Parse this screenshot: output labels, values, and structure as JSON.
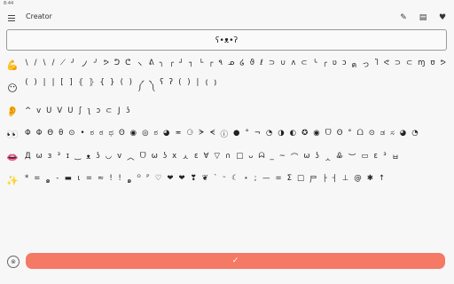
{
  "status": {
    "time": "8:44"
  },
  "appbar": {
    "title": "Creator",
    "icons": [
      "brush-icon",
      "template-icon",
      "heart-icon"
    ],
    "icon_glyphs": [
      "✎",
      "▤",
      "♥"
    ]
  },
  "preview": {
    "text": "ʕ•ᴥ•ʔ"
  },
  "rows": [
    {
      "category": "arms",
      "icon": "💪",
      "chars": [
        "\\",
        "/",
        "\\",
        "/",
        "⟋",
        "╯",
        "ノ",
        "╯",
        "ᕗ",
        "ᕤ",
        "ᕦ",
        "ヽ",
        "ᕕ",
        "╮",
        "╭",
        "┘",
        "┐",
        "└",
        "┌",
        "٩",
        "ᓄ",
        "໒",
        "ϑ",
        "ℓ",
        "⊃",
        "∪",
        "ʌ",
        "⊂",
        "╰",
        "╭",
        "ʋ",
        "ɔ",
        "ค",
        "っ",
        "Ⴈ",
        "ᕙ",
        "⊃",
        "⊂",
        "ɱ",
        "ʊ",
        "ᕗ"
      ]
    },
    {
      "category": "face",
      "icon": "😶",
      "chars": [
        "(",
        ")",
        "|",
        "|",
        "[",
        "]",
        "⦃",
        "⦄",
        "{",
        "}",
        "(",
        ")",
        "༼",
        "༽",
        "ʕ",
        "ʔ",
        "(",
        ")",
        "|",
        "⦅",
        "⦆"
      ]
    },
    {
      "category": "ears",
      "icon": "👂",
      "chars": [
        "^",
        "v",
        "U",
        "V",
        "U",
        "ʃ",
        "ʅ",
        "ɔ",
        "⊂",
        "J",
        "ʖ"
      ]
    },
    {
      "category": "eyes",
      "icon": "👀",
      "chars": [
        "Φ",
        "Φ",
        "Θ",
        "θ",
        "⊙",
        "•",
        "ಠ",
        "ಠ",
        "ಥ",
        "ʘ",
        "◉",
        "◎",
        "ಠ",
        "◕",
        "≖",
        "⚆",
        "ᗒ",
        "ᗕ",
        "ⓘ",
        "●",
        "°",
        "¬",
        "◔",
        "◑",
        "◐",
        "✪",
        "◉",
        "ᗜ",
        "ʘ",
        "͡°",
        "ᗝ",
        "⊙",
        "ಡ",
        "ಸ",
        "◕",
        "◔"
      ]
    },
    {
      "category": "mouth",
      "icon": "👄",
      "chars": [
        "Д",
        "ω",
        "ɜ",
        "³",
        "ɪ",
        "‿",
        "ᴥ",
        "ʖ",
        "◡",
        "v",
        "︿",
        "ᗜ",
        "ω",
        "ʖ",
        "x",
        "ㅅ",
        "ε",
        "∀",
        "▽",
        "∩",
        "□",
        "ᴗ",
        "ᗣ",
        "_",
        "~",
        "⌒",
        "ω",
        "ʖ",
        "ᆺ",
        "Ꮂ",
        "︶",
        "▭",
        "ε",
        "³",
        "ㅂ"
      ]
    },
    {
      "category": "extras",
      "icon": "✨",
      "chars": [
        "*",
        "=",
        "๑",
        "-",
        "▬",
        "ι",
        "=",
        "≈",
        "!",
        "!",
        "๑",
        "ᴼ",
        "ᴾ",
        "♡",
        "❤",
        "❤",
        "❣",
        "❦",
        "`",
        "ᵕ",
        "☾",
        "⋆",
        ";",
        "—",
        "=",
        "Σ",
        "□",
        "尸",
        "├",
        "┤",
        "⊥",
        "@",
        "✱",
        "↑"
      ]
    }
  ],
  "bottom": {
    "clear_icon": "⊗",
    "confirm_icon": "✓"
  }
}
